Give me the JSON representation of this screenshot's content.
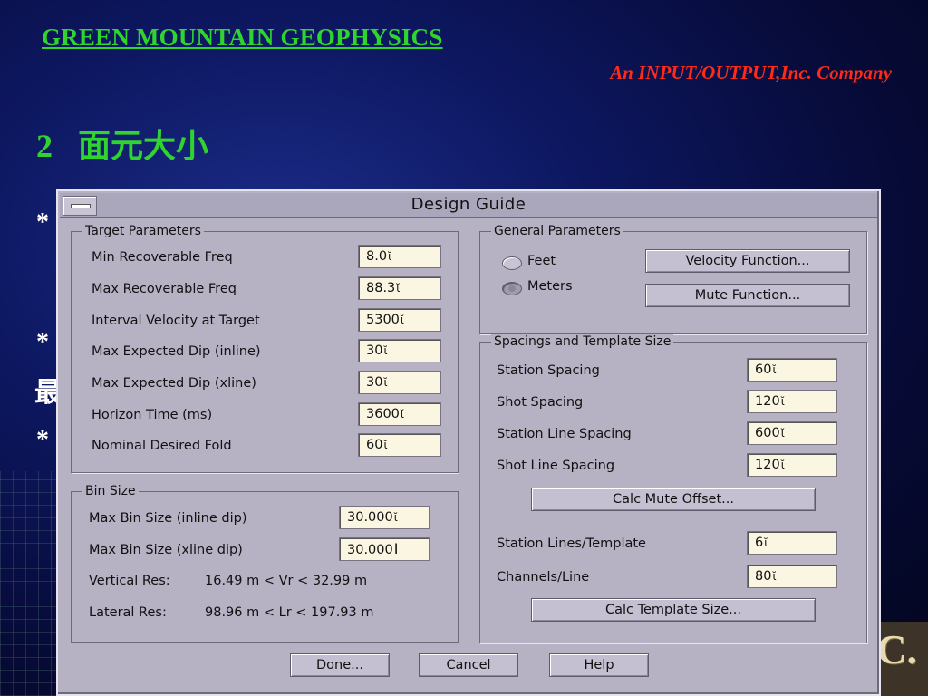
{
  "header": {
    "company": "GREEN MOUNTAIN GEOPHYSICS",
    "subtitle": "An INPUT/OUTPUT,Inc. Company",
    "section_number": "2",
    "section_title": "面元大小"
  },
  "background_text": {
    "bullet_1": "*",
    "bullet_2": "*",
    "bullet_2_char": "最",
    "bullet_3": "*",
    "corner_fragment": "C."
  },
  "dialog": {
    "title": "Design Guide",
    "target_parameters": {
      "title": "Target Parameters",
      "rows": [
        {
          "label": "Min Recoverable Freq",
          "value": "8.0"
        },
        {
          "label": "Max Recoverable Freq",
          "value": "88.3"
        },
        {
          "label": "Interval Velocity at Target",
          "value": "5300"
        },
        {
          "label": "Max Expected Dip (inline)",
          "value": "30"
        },
        {
          "label": "Max Expected Dip (xline)",
          "value": "30"
        },
        {
          "label": "Horizon Time (ms)",
          "value": "3600"
        },
        {
          "label": "Nominal Desired Fold",
          "value": "60"
        }
      ]
    },
    "bin_size": {
      "title": "Bin Size",
      "rows": [
        {
          "label": "Max Bin Size (inline dip)",
          "value": "30.000"
        },
        {
          "label": "Max Bin Size (xline dip)",
          "value": "30.000"
        }
      ],
      "vertical_res_label": "Vertical Res:",
      "vertical_res_value": "16.49 m < Vr < 32.99 m",
      "lateral_res_label": "Lateral Res:",
      "lateral_res_value": "98.96 m < Lr < 197.93 m"
    },
    "general_parameters": {
      "title": "General Parameters",
      "units": [
        {
          "label": "Feet",
          "selected": false
        },
        {
          "label": "Meters",
          "selected": true
        }
      ],
      "velocity_button": "Velocity Function...",
      "mute_button": "Mute Function..."
    },
    "spacings": {
      "title": "Spacings and Template Size",
      "rows": [
        {
          "label": "Station Spacing",
          "value": "60"
        },
        {
          "label": "Shot Spacing",
          "value": "120"
        },
        {
          "label": "Station Line Spacing",
          "value": "600"
        },
        {
          "label": "Shot Line Spacing",
          "value": "120"
        }
      ],
      "calc_mute_button": "Calc Mute Offset...",
      "rows2": [
        {
          "label": "Station Lines/Template",
          "value": "6"
        },
        {
          "label": "Channels/Line",
          "value": "80"
        }
      ],
      "calc_template_button": "Calc Template Size..."
    },
    "footer": {
      "done": "Done...",
      "cancel": "Cancel",
      "help": "Help"
    }
  },
  "icons": {
    "caret": "text-cursor-icon",
    "window_menu": "window-menu-icon"
  }
}
